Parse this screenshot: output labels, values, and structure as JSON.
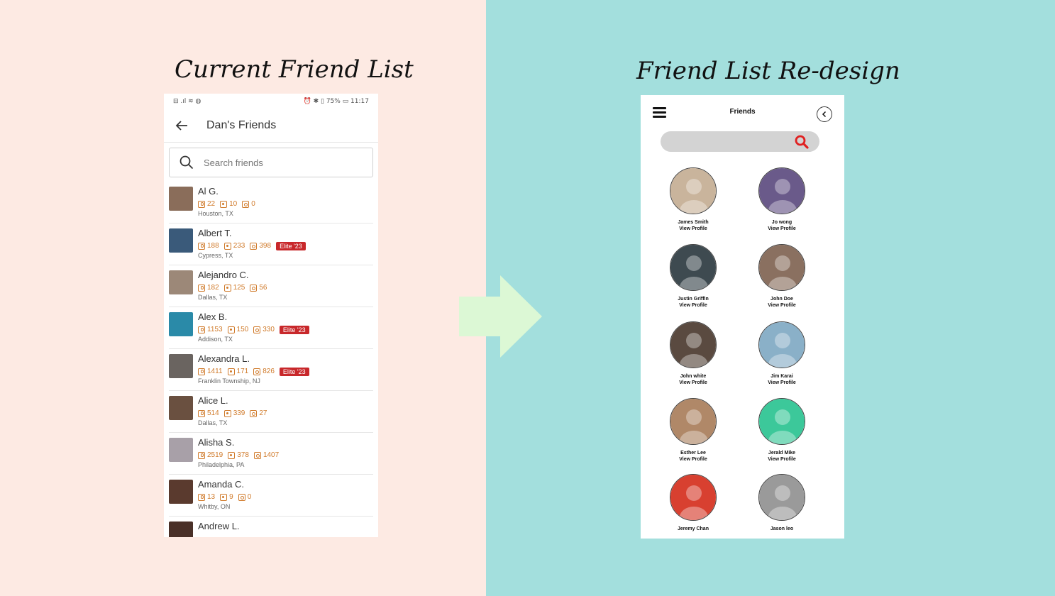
{
  "left_title": "Current Friend List",
  "right_title": "Friend List Re-design",
  "colors": {
    "left_bg": "#fdeae3",
    "right_bg": "#a3dfdd",
    "arrow": "#dcf8d5",
    "stat_orange": "#d07a2a",
    "elite_red": "#c8282b",
    "search_red": "#e02020"
  },
  "current_app": {
    "status_left": "⊟ .ıl ≋ ◍",
    "status_right": "⏰ ✱ ▯ 75% ▭ 11:17",
    "title": "Dan's Friends",
    "search_placeholder": "Search friends",
    "friends": [
      {
        "name": "Al G.",
        "reviews": "22",
        "stars": "10",
        "photos": "0",
        "elite": "",
        "location": "Houston, TX",
        "avatar_color": "#8a6d5a"
      },
      {
        "name": "Albert T.",
        "reviews": "188",
        "stars": "233",
        "photos": "398",
        "elite": "Elite '23",
        "location": "Cypress, TX",
        "avatar_color": "#3a5a7a"
      },
      {
        "name": "Alejandro C.",
        "reviews": "182",
        "stars": "125",
        "photos": "56",
        "elite": "",
        "location": "Dallas, TX",
        "avatar_color": "#9c8878"
      },
      {
        "name": "Alex B.",
        "reviews": "1153",
        "stars": "150",
        "photos": "330",
        "elite": "Elite '23",
        "location": "Addison, TX",
        "avatar_color": "#2a8aa8"
      },
      {
        "name": "Alexandra L.",
        "reviews": "1411",
        "stars": "171",
        "photos": "826",
        "elite": "Elite '23",
        "location": "Franklin Township, NJ",
        "avatar_color": "#6a6460"
      },
      {
        "name": "Alice L.",
        "reviews": "514",
        "stars": "339",
        "photos": "27",
        "elite": "",
        "location": "Dallas, TX",
        "avatar_color": "#6a5040"
      },
      {
        "name": "Alisha S.",
        "reviews": "2519",
        "stars": "378",
        "photos": "1407",
        "elite": "",
        "location": "Philadelphia, PA",
        "avatar_color": "#a8a0a8"
      },
      {
        "name": "Amanda C.",
        "reviews": "13",
        "stars": "9",
        "photos": "0",
        "elite": "",
        "location": "Whitby, ON",
        "avatar_color": "#5a3a2e"
      },
      {
        "name": "Andrew L.",
        "reviews": "",
        "stars": "",
        "photos": "",
        "elite": "",
        "location": "",
        "avatar_color": "#4a3028"
      }
    ]
  },
  "redesign_app": {
    "title": "Friends",
    "view_profile_label": "View Profile",
    "friends": [
      {
        "name": "James Smith",
        "show_view_profile": true,
        "color": "#c9b49c"
      },
      {
        "name": "Jo wong",
        "show_view_profile": true,
        "color": "#6a5a8a"
      },
      {
        "name": "Justin Griffin",
        "show_view_profile": true,
        "color": "#3e4a50"
      },
      {
        "name": "John Doe",
        "show_view_profile": true,
        "color": "#8a7060"
      },
      {
        "name": "John white",
        "show_view_profile": true,
        "color": "#5a4a40"
      },
      {
        "name": "Jim Karai",
        "show_view_profile": true,
        "color": "#8ab0c8"
      },
      {
        "name": "Esther Lee",
        "show_view_profile": true,
        "color": "#b08868"
      },
      {
        "name": "Jerald Mike",
        "show_view_profile": true,
        "color": "#3cc89a"
      },
      {
        "name": "Jeremy Chan",
        "show_view_profile": false,
        "color": "#d84030"
      },
      {
        "name": "Jason leo",
        "show_view_profile": false,
        "color": "#9a9a9a"
      }
    ]
  }
}
